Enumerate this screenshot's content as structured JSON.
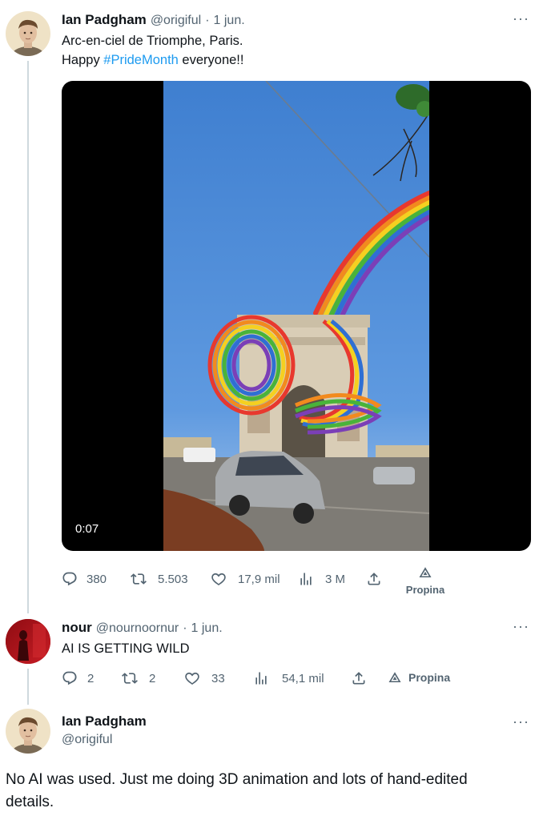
{
  "tweet1": {
    "name": "Ian Padgham",
    "handle": "@origiful",
    "sep": "·",
    "date": "1 jun.",
    "line1": "Arc-en-ciel de Triomphe, Paris.",
    "line2_pre": "Happy ",
    "hashtag": "#PrideMonth",
    "line2_post": " everyone!!",
    "video_time": "0:07",
    "actions": {
      "replies": "380",
      "retweets": "5.503",
      "likes": "17,9 mil",
      "views": "3 M",
      "tip": "Propina"
    }
  },
  "tweet2": {
    "name": "nour",
    "handle": "@nournoornur",
    "sep": "·",
    "date": "1 jun.",
    "text": "AI IS GETTING WILD",
    "actions": {
      "replies": "2",
      "retweets": "2",
      "likes": "33",
      "views": "54,1 mil",
      "tip": "Propina"
    }
  },
  "tweet3": {
    "name": "Ian Padgham",
    "handle": "@origiful",
    "text": "No AI was used. Just me doing 3D animation and lots of hand-edited details."
  },
  "more_label": "···",
  "icons": [
    "reply-icon",
    "retweet-icon",
    "like-icon",
    "views-icon",
    "share-icon",
    "tip-icon"
  ],
  "colors": {
    "text": "#0f1419",
    "secondary": "#536471",
    "link": "#1d9bf0",
    "line": "#cfd9de"
  }
}
